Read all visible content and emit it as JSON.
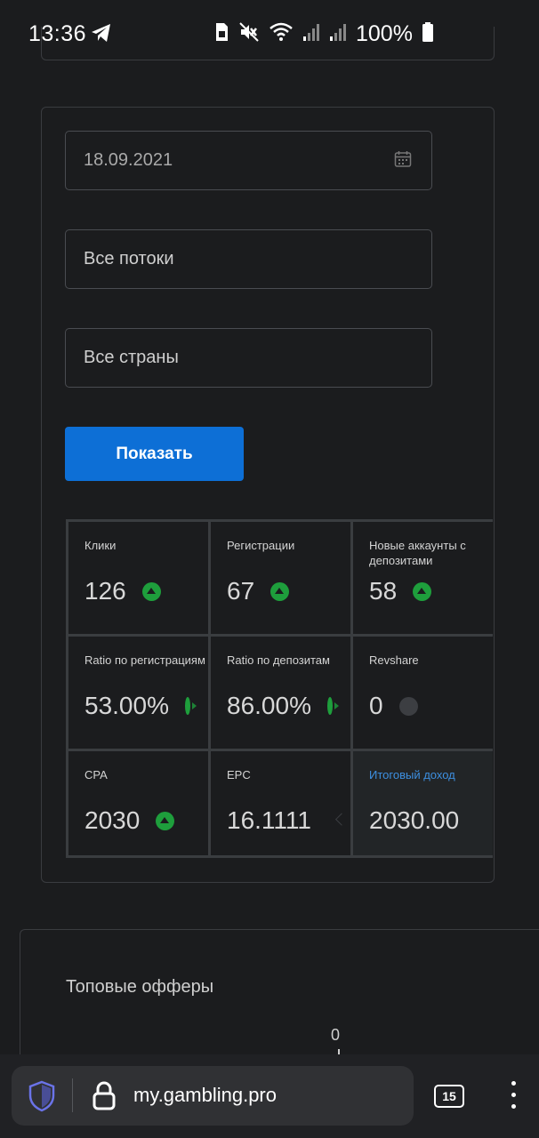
{
  "status_bar": {
    "time": "13:36",
    "battery": "100%",
    "icons": [
      "telegram-icon",
      "sim-icon",
      "mute-icon",
      "wifi-icon",
      "signal-icon",
      "signal-icon",
      "battery-icon"
    ]
  },
  "filters": {
    "date_value": "18.09.2021",
    "flows_value": "Все потоки",
    "countries_value": "Все страны",
    "show_button": "Показать"
  },
  "stats": [
    {
      "label": "Клики",
      "value": "126",
      "trend": "up"
    },
    {
      "label": "Регистрации",
      "value": "67",
      "trend": "up"
    },
    {
      "label": "Новые аккаунты с депозитами",
      "value": "58",
      "trend": "up"
    },
    {
      "label": "Ratio по регистрациям",
      "value": "53.00%",
      "trend": "side"
    },
    {
      "label": "Ratio по депозитам",
      "value": "86.00%",
      "trend": "side"
    },
    {
      "label": "Revshare",
      "value": "0",
      "trend": "flat"
    },
    {
      "label": "CPA",
      "value": "2030",
      "trend": "up"
    },
    {
      "label": "EPC",
      "value": "16.1111",
      "trend": "faint"
    },
    {
      "label": "Итоговый доход",
      "value": "2030.00",
      "trend": "none"
    }
  ],
  "offers": {
    "title": "Топовые офферы",
    "axis_zero": "0"
  },
  "browser": {
    "url": "my.gambling.pro",
    "tab_count": "15"
  },
  "colors": {
    "background": "#1b1c1e",
    "accent_button": "#0d6fd6",
    "trend_up": "#1e9e3c",
    "highlight_label": "#3d8fe0"
  }
}
